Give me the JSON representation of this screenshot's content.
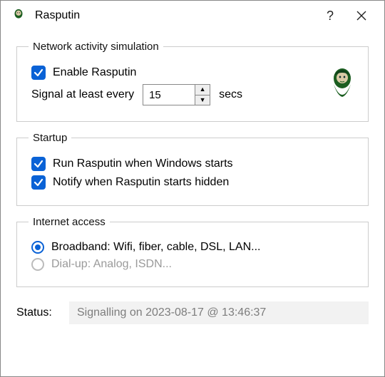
{
  "window": {
    "title": "Rasputin"
  },
  "groups": {
    "network": {
      "legend": "Network activity simulation",
      "enable_label": "Enable Rasputin",
      "enable_checked": true,
      "interval_prefix": "Signal at least every",
      "interval_value": "15",
      "interval_suffix": "secs"
    },
    "startup": {
      "legend": "Startup",
      "run_label": "Run Rasputin when Windows starts",
      "run_checked": true,
      "notify_label": "Notify when Rasputin starts hidden",
      "notify_checked": true
    },
    "internet": {
      "legend": "Internet access",
      "broadband_label": "Broadband: Wifi, fiber, cable, DSL, LAN...",
      "broadband_selected": true,
      "dialup_label": "Dial-up: Analog, ISDN...",
      "dialup_enabled": false
    }
  },
  "status": {
    "label": "Status:",
    "value": "Signalling on 2023-08-17 @ 13:46:37"
  },
  "icons": {
    "app": "rasputin-head",
    "portrait": "rasputin-portrait"
  }
}
